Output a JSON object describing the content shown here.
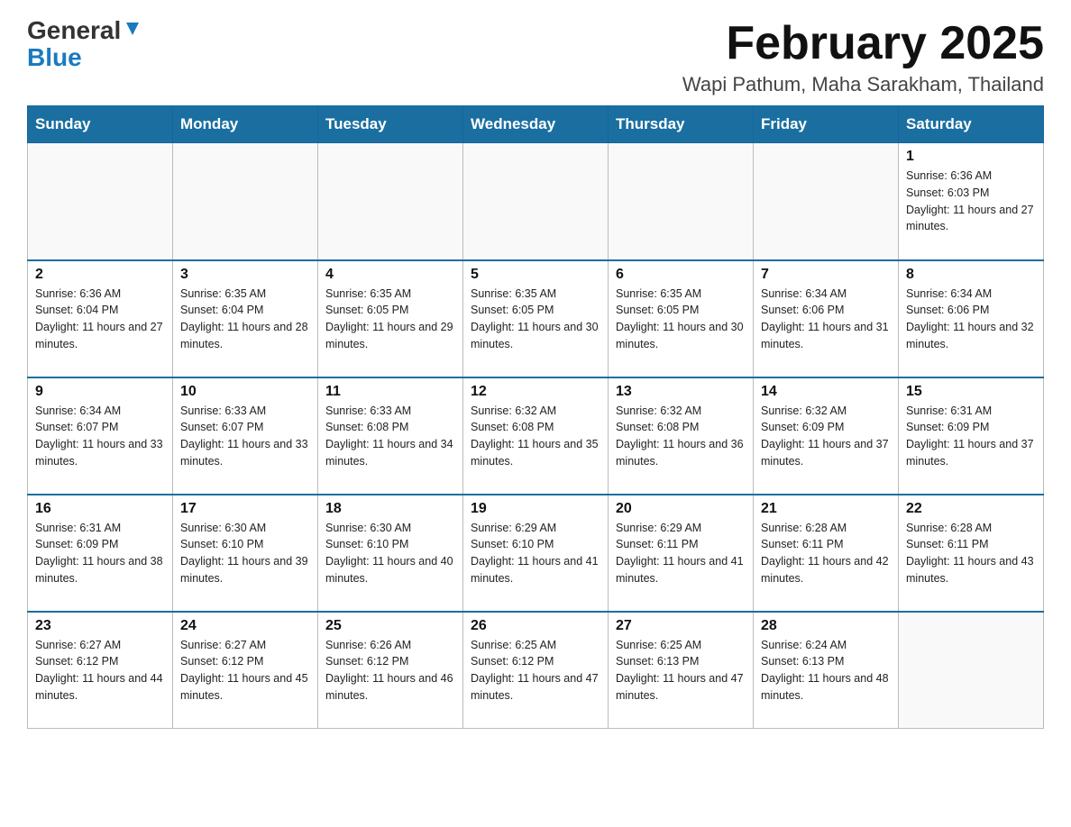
{
  "header": {
    "logo_general": "General",
    "logo_blue": "Blue",
    "month_title": "February 2025",
    "location": "Wapi Pathum, Maha Sarakham, Thailand"
  },
  "weekdays": [
    "Sunday",
    "Monday",
    "Tuesday",
    "Wednesday",
    "Thursday",
    "Friday",
    "Saturday"
  ],
  "weeks": [
    [
      {
        "day": "",
        "sunrise": "",
        "sunset": "",
        "daylight": ""
      },
      {
        "day": "",
        "sunrise": "",
        "sunset": "",
        "daylight": ""
      },
      {
        "day": "",
        "sunrise": "",
        "sunset": "",
        "daylight": ""
      },
      {
        "day": "",
        "sunrise": "",
        "sunset": "",
        "daylight": ""
      },
      {
        "day": "",
        "sunrise": "",
        "sunset": "",
        "daylight": ""
      },
      {
        "day": "",
        "sunrise": "",
        "sunset": "",
        "daylight": ""
      },
      {
        "day": "1",
        "sunrise": "Sunrise: 6:36 AM",
        "sunset": "Sunset: 6:03 PM",
        "daylight": "Daylight: 11 hours and 27 minutes."
      }
    ],
    [
      {
        "day": "2",
        "sunrise": "Sunrise: 6:36 AM",
        "sunset": "Sunset: 6:04 PM",
        "daylight": "Daylight: 11 hours and 27 minutes."
      },
      {
        "day": "3",
        "sunrise": "Sunrise: 6:35 AM",
        "sunset": "Sunset: 6:04 PM",
        "daylight": "Daylight: 11 hours and 28 minutes."
      },
      {
        "day": "4",
        "sunrise": "Sunrise: 6:35 AM",
        "sunset": "Sunset: 6:05 PM",
        "daylight": "Daylight: 11 hours and 29 minutes."
      },
      {
        "day": "5",
        "sunrise": "Sunrise: 6:35 AM",
        "sunset": "Sunset: 6:05 PM",
        "daylight": "Daylight: 11 hours and 30 minutes."
      },
      {
        "day": "6",
        "sunrise": "Sunrise: 6:35 AM",
        "sunset": "Sunset: 6:05 PM",
        "daylight": "Daylight: 11 hours and 30 minutes."
      },
      {
        "day": "7",
        "sunrise": "Sunrise: 6:34 AM",
        "sunset": "Sunset: 6:06 PM",
        "daylight": "Daylight: 11 hours and 31 minutes."
      },
      {
        "day": "8",
        "sunrise": "Sunrise: 6:34 AM",
        "sunset": "Sunset: 6:06 PM",
        "daylight": "Daylight: 11 hours and 32 minutes."
      }
    ],
    [
      {
        "day": "9",
        "sunrise": "Sunrise: 6:34 AM",
        "sunset": "Sunset: 6:07 PM",
        "daylight": "Daylight: 11 hours and 33 minutes."
      },
      {
        "day": "10",
        "sunrise": "Sunrise: 6:33 AM",
        "sunset": "Sunset: 6:07 PM",
        "daylight": "Daylight: 11 hours and 33 minutes."
      },
      {
        "day": "11",
        "sunrise": "Sunrise: 6:33 AM",
        "sunset": "Sunset: 6:08 PM",
        "daylight": "Daylight: 11 hours and 34 minutes."
      },
      {
        "day": "12",
        "sunrise": "Sunrise: 6:32 AM",
        "sunset": "Sunset: 6:08 PM",
        "daylight": "Daylight: 11 hours and 35 minutes."
      },
      {
        "day": "13",
        "sunrise": "Sunrise: 6:32 AM",
        "sunset": "Sunset: 6:08 PM",
        "daylight": "Daylight: 11 hours and 36 minutes."
      },
      {
        "day": "14",
        "sunrise": "Sunrise: 6:32 AM",
        "sunset": "Sunset: 6:09 PM",
        "daylight": "Daylight: 11 hours and 37 minutes."
      },
      {
        "day": "15",
        "sunrise": "Sunrise: 6:31 AM",
        "sunset": "Sunset: 6:09 PM",
        "daylight": "Daylight: 11 hours and 37 minutes."
      }
    ],
    [
      {
        "day": "16",
        "sunrise": "Sunrise: 6:31 AM",
        "sunset": "Sunset: 6:09 PM",
        "daylight": "Daylight: 11 hours and 38 minutes."
      },
      {
        "day": "17",
        "sunrise": "Sunrise: 6:30 AM",
        "sunset": "Sunset: 6:10 PM",
        "daylight": "Daylight: 11 hours and 39 minutes."
      },
      {
        "day": "18",
        "sunrise": "Sunrise: 6:30 AM",
        "sunset": "Sunset: 6:10 PM",
        "daylight": "Daylight: 11 hours and 40 minutes."
      },
      {
        "day": "19",
        "sunrise": "Sunrise: 6:29 AM",
        "sunset": "Sunset: 6:10 PM",
        "daylight": "Daylight: 11 hours and 41 minutes."
      },
      {
        "day": "20",
        "sunrise": "Sunrise: 6:29 AM",
        "sunset": "Sunset: 6:11 PM",
        "daylight": "Daylight: 11 hours and 41 minutes."
      },
      {
        "day": "21",
        "sunrise": "Sunrise: 6:28 AM",
        "sunset": "Sunset: 6:11 PM",
        "daylight": "Daylight: 11 hours and 42 minutes."
      },
      {
        "day": "22",
        "sunrise": "Sunrise: 6:28 AM",
        "sunset": "Sunset: 6:11 PM",
        "daylight": "Daylight: 11 hours and 43 minutes."
      }
    ],
    [
      {
        "day": "23",
        "sunrise": "Sunrise: 6:27 AM",
        "sunset": "Sunset: 6:12 PM",
        "daylight": "Daylight: 11 hours and 44 minutes."
      },
      {
        "day": "24",
        "sunrise": "Sunrise: 6:27 AM",
        "sunset": "Sunset: 6:12 PM",
        "daylight": "Daylight: 11 hours and 45 minutes."
      },
      {
        "day": "25",
        "sunrise": "Sunrise: 6:26 AM",
        "sunset": "Sunset: 6:12 PM",
        "daylight": "Daylight: 11 hours and 46 minutes."
      },
      {
        "day": "26",
        "sunrise": "Sunrise: 6:25 AM",
        "sunset": "Sunset: 6:12 PM",
        "daylight": "Daylight: 11 hours and 47 minutes."
      },
      {
        "day": "27",
        "sunrise": "Sunrise: 6:25 AM",
        "sunset": "Sunset: 6:13 PM",
        "daylight": "Daylight: 11 hours and 47 minutes."
      },
      {
        "day": "28",
        "sunrise": "Sunrise: 6:24 AM",
        "sunset": "Sunset: 6:13 PM",
        "daylight": "Daylight: 11 hours and 48 minutes."
      },
      {
        "day": "",
        "sunrise": "",
        "sunset": "",
        "daylight": ""
      }
    ]
  ]
}
